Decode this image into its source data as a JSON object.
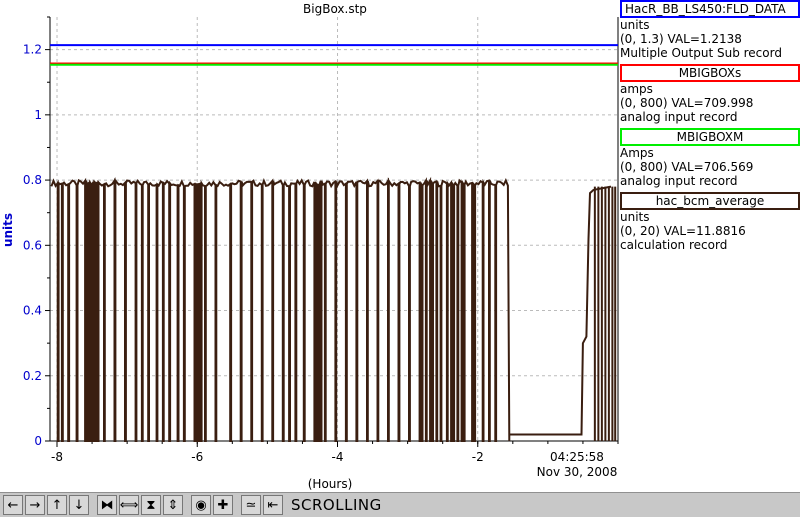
{
  "chart_data": {
    "type": "line",
    "title": "BigBox.stp",
    "xlabel": "(Hours)",
    "ylabel": "units",
    "xlim": [
      -8.1,
      0
    ],
    "ylim": [
      0,
      1.3
    ],
    "grid": true,
    "x_ticks": [
      -8,
      -6,
      -4,
      -2
    ],
    "y_ticks": [
      0,
      0.2,
      0.4,
      0.6,
      0.8,
      1.0,
      1.2
    ],
    "y_tick_labels": [
      "0",
      "0.2",
      "0.4",
      "0.6",
      "0.8",
      "1",
      "1.2"
    ],
    "time_label": "04:25:58",
    "date_label": "Nov 30, 2008",
    "series": [
      {
        "name": "HacR_BB_LS450:FLD_DATA",
        "color": "#0000ff",
        "constant": 1.2138
      },
      {
        "name": "MBIGBOXs",
        "color": "#ff0000",
        "constant": 1.1575
      },
      {
        "name": "MBIGBOXM",
        "color": "#00ee00",
        "constant": 1.1535
      },
      {
        "name": "hac_bcm_average",
        "color": "#3a1e10",
        "baseline": 0.79,
        "drops": [
          -8.02,
          -7.95,
          -7.84,
          -7.73,
          -7.62,
          -7.6,
          -7.58,
          -7.56,
          -7.54,
          -7.52,
          -7.5,
          -7.35,
          -7.2,
          -7.05,
          -6.9,
          -6.8,
          -6.7,
          -6.6,
          -6.5,
          -6.4,
          -6.3,
          -6.2,
          -6.05,
          -6.02,
          -5.99,
          -5.96,
          -5.9,
          -5.75,
          -5.55,
          -5.4,
          -5.25,
          -5.1,
          -4.95,
          -4.8,
          -4.7,
          -4.6,
          -4.5,
          -4.35,
          -4.32,
          -4.29,
          -4.26,
          -4.2,
          -4.05,
          -3.9,
          -3.75,
          -3.6,
          -3.45,
          -3.3,
          -3.15,
          -3.0,
          -2.85,
          -2.8,
          -2.75,
          -2.7,
          -2.65,
          -2.6,
          -2.55,
          -2.45,
          -2.4,
          -2.35,
          -2.3,
          -2.25,
          -2.2,
          -2.1,
          -2.05,
          -1.95,
          -1.85,
          -1.75
        ],
        "outage": {
          "x_start": -1.55,
          "x_end": -0.52,
          "value": 0.02
        },
        "recovery": [
          [
            -0.52,
            0.02
          ],
          [
            -0.5,
            0.3
          ],
          [
            -0.45,
            0.32
          ],
          [
            -0.42,
            0.62
          ],
          [
            -0.4,
            0.76
          ],
          [
            -0.35,
            0.77
          ],
          [
            -0.1,
            0.78
          ]
        ],
        "late_drops": [
          -0.33,
          -0.28,
          -0.23,
          -0.18,
          -0.13,
          -0.08,
          -0.04
        ]
      }
    ]
  },
  "legend": [
    {
      "name": "HacR_BB_LS450:FLD_DATA",
      "color": "#0000ff",
      "units": "units",
      "range_val": "(0, 1.3) VAL=1.2138",
      "record": "Multiple Output Sub record"
    },
    {
      "name": "MBIGBOXs",
      "color": "#ff0000",
      "units": "amps",
      "range_val": "(0, 800) VAL=709.998",
      "record": "analog input record"
    },
    {
      "name": "MBIGBOXM",
      "color": "#00ee00",
      "units": "Amps",
      "range_val": "(0, 800) VAL=706.569",
      "record": "analog input record"
    },
    {
      "name": "hac_bcm_average",
      "color": "#3a1e10",
      "units": "units",
      "range_val": "(0, 20) VAL=11.8816",
      "record": "calculation record"
    }
  ],
  "toolbar": {
    "buttons": [
      {
        "name": "pan-left-icon",
        "glyph": "←"
      },
      {
        "name": "pan-right-icon",
        "glyph": "→"
      },
      {
        "name": "pan-up-icon",
        "glyph": "↑"
      },
      {
        "name": "pan-down-icon",
        "glyph": "↓"
      },
      {
        "name": "zoom-in-horizontal-icon",
        "glyph": "⧓"
      },
      {
        "name": "zoom-out-horizontal-icon",
        "glyph": "⟺"
      },
      {
        "name": "zoom-in-vertical-icon",
        "glyph": "⧗"
      },
      {
        "name": "zoom-out-vertical-icon",
        "glyph": "⇕"
      },
      {
        "name": "auto-scale-icon",
        "glyph": "◉"
      },
      {
        "name": "add-marker-icon",
        "glyph": "✚"
      },
      {
        "name": "trend-mode-icon",
        "glyph": "≃"
      },
      {
        "name": "back-to-live-icon",
        "glyph": "⇤"
      }
    ],
    "status": "SCROLLING"
  }
}
